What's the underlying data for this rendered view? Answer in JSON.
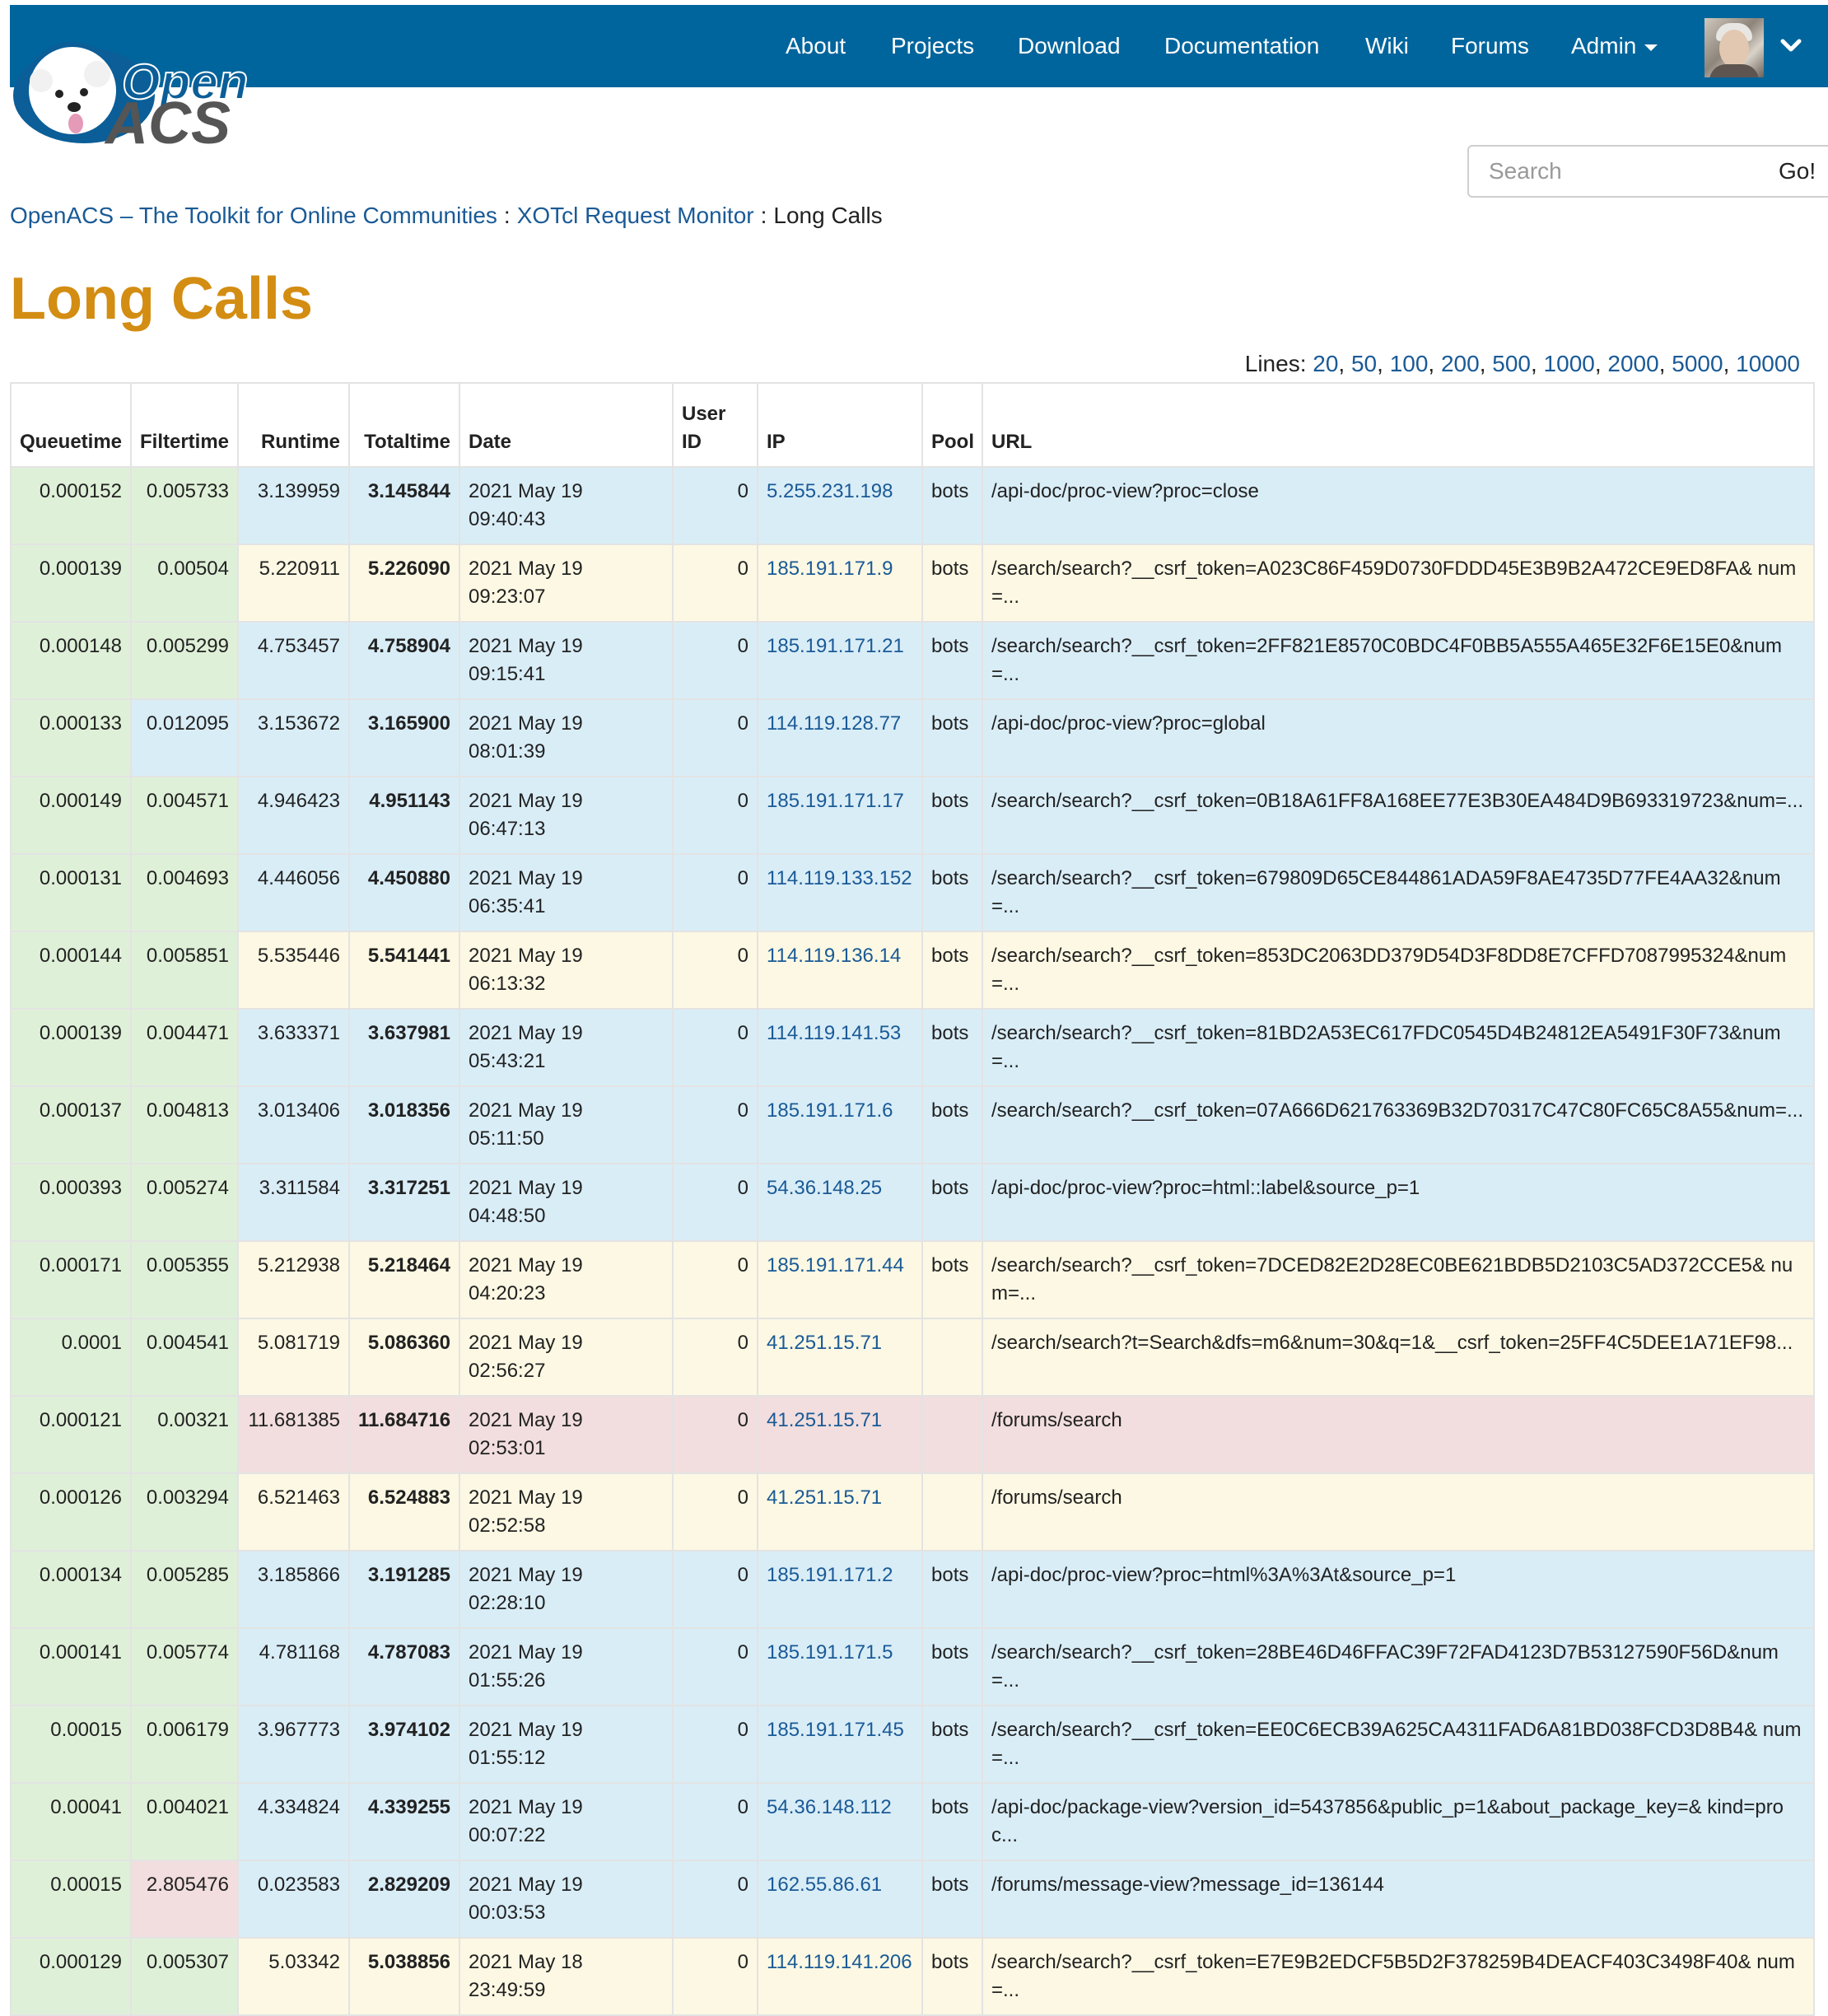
{
  "nav": {
    "items": [
      "About",
      "Projects",
      "Download",
      "Documentation",
      "Wiki",
      "Forums",
      "Admin"
    ],
    "brand_color": "#00659d"
  },
  "logo": {
    "text_top": "Open",
    "text_bottom": "ACS"
  },
  "search": {
    "placeholder": "Search",
    "button_label": "Go!"
  },
  "breadcrumb": {
    "items": [
      "OpenACS – The Toolkit for Online Communities",
      "XOTcl Request Monitor"
    ],
    "separator": ":",
    "current": "Long Calls"
  },
  "page_title": "Long Calls",
  "lines": {
    "label": "Lines:",
    "options": [
      "20",
      "50",
      "100",
      "200",
      "500",
      "1000",
      "2000",
      "5000",
      "10000"
    ]
  },
  "table": {
    "headers": [
      "Queuetime",
      "Filtertime",
      "Runtime",
      "Totaltime",
      "Date",
      "User ID",
      "IP",
      "Pool",
      "URL"
    ],
    "rows": [
      {
        "q": "0.000152",
        "f": "0.005733",
        "r": "3.139959",
        "t": "3.145844",
        "date": "2021 May 19 09:40:43",
        "uid": "0",
        "ip": "5.255.231.198",
        "pool": "bots",
        "url": "/api-doc/proc-view?proc=close",
        "fc": "green",
        "rc": "blue"
      },
      {
        "q": "0.000139",
        "f": "0.00504",
        "r": "5.220911",
        "t": "5.226090",
        "date": "2021 May 19 09:23:07",
        "uid": "0",
        "ip": "185.191.171.9",
        "pool": "bots",
        "url": "/search/search?__csrf_token=A023C86F459D0730FDDD45E3B9B2A472CE9ED8FA& num=...",
        "fc": "green",
        "rc": "yellow"
      },
      {
        "q": "0.000148",
        "f": "0.005299",
        "r": "4.753457",
        "t": "4.758904",
        "date": "2021 May 19 09:15:41",
        "uid": "0",
        "ip": "185.191.171.21",
        "pool": "bots",
        "url": "/search/search?__csrf_token=2FF821E8570C0BDC4F0BB5A555A465E32F6E15E0&num=...",
        "fc": "green",
        "rc": "blue"
      },
      {
        "q": "0.000133",
        "f": "0.012095",
        "r": "3.153672",
        "t": "3.165900",
        "date": "2021 May 19 08:01:39",
        "uid": "0",
        "ip": "114.119.128.77",
        "pool": "bots",
        "url": "/api-doc/proc-view?proc=global",
        "fc": "blue",
        "rc": "blue"
      },
      {
        "q": "0.000149",
        "f": "0.004571",
        "r": "4.946423",
        "t": "4.951143",
        "date": "2021 May 19 06:47:13",
        "uid": "0",
        "ip": "185.191.171.17",
        "pool": "bots",
        "url": "/search/search?__csrf_token=0B18A61FF8A168EE77E3B30EA484D9B693319723&num=...",
        "fc": "green",
        "rc": "blue"
      },
      {
        "q": "0.000131",
        "f": "0.004693",
        "r": "4.446056",
        "t": "4.450880",
        "date": "2021 May 19 06:35:41",
        "uid": "0",
        "ip": "114.119.133.152",
        "pool": "bots",
        "url": "/search/search?__csrf_token=679809D65CE844861ADA59F8AE4735D77FE4AA32&num=...",
        "fc": "green",
        "rc": "blue"
      },
      {
        "q": "0.000144",
        "f": "0.005851",
        "r": "5.535446",
        "t": "5.541441",
        "date": "2021 May 19 06:13:32",
        "uid": "0",
        "ip": "114.119.136.14",
        "pool": "bots",
        "url": "/search/search?__csrf_token=853DC2063DD379D54D3F8DD8E7CFFD7087995324&num=...",
        "fc": "green",
        "rc": "yellow"
      },
      {
        "q": "0.000139",
        "f": "0.004471",
        "r": "3.633371",
        "t": "3.637981",
        "date": "2021 May 19 05:43:21",
        "uid": "0",
        "ip": "114.119.141.53",
        "pool": "bots",
        "url": "/search/search?__csrf_token=81BD2A53EC617FDC0545D4B24812EA5491F30F73&num=...",
        "fc": "green",
        "rc": "blue"
      },
      {
        "q": "0.000137",
        "f": "0.004813",
        "r": "3.013406",
        "t": "3.018356",
        "date": "2021 May 19 05:11:50",
        "uid": "0",
        "ip": "185.191.171.6",
        "pool": "bots",
        "url": "/search/search?__csrf_token=07A666D621763369B32D70317C47C80FC65C8A55&num=...",
        "fc": "green",
        "rc": "blue"
      },
      {
        "q": "0.000393",
        "f": "0.005274",
        "r": "3.311584",
        "t": "3.317251",
        "date": "2021 May 19 04:48:50",
        "uid": "0",
        "ip": "54.36.148.25",
        "pool": "bots",
        "url": "/api-doc/proc-view?proc=html::label&source_p=1",
        "fc": "green",
        "rc": "blue"
      },
      {
        "q": "0.000171",
        "f": "0.005355",
        "r": "5.212938",
        "t": "5.218464",
        "date": "2021 May 19 04:20:23",
        "uid": "0",
        "ip": "185.191.171.44",
        "pool": "bots",
        "url": "/search/search?__csrf_token=7DCED82E2D28EC0BE621BDB5D2103C5AD372CCE5& num=...",
        "fc": "green",
        "rc": "yellow"
      },
      {
        "q": "0.0001",
        "f": "0.004541",
        "r": "5.081719",
        "t": "5.086360",
        "date": "2021 May 19 02:56:27",
        "uid": "0",
        "ip": "41.251.15.71",
        "pool": "",
        "url": "/search/search?t=Search&dfs=m6&num=30&q=1&__csrf_token=25FF4C5DEE1A71EF98...",
        "fc": "green",
        "rc": "yellow"
      },
      {
        "q": "0.000121",
        "f": "0.00321",
        "r": "11.681385",
        "t": "11.684716",
        "date": "2021 May 19 02:53:01",
        "uid": "0",
        "ip": "41.251.15.71",
        "pool": "",
        "url": "/forums/search",
        "fc": "green",
        "rc": "red"
      },
      {
        "q": "0.000126",
        "f": "0.003294",
        "r": "6.521463",
        "t": "6.524883",
        "date": "2021 May 19 02:52:58",
        "uid": "0",
        "ip": "41.251.15.71",
        "pool": "",
        "url": "/forums/search",
        "fc": "green",
        "rc": "yellow"
      },
      {
        "q": "0.000134",
        "f": "0.005285",
        "r": "3.185866",
        "t": "3.191285",
        "date": "2021 May 19 02:28:10",
        "uid": "0",
        "ip": "185.191.171.2",
        "pool": "bots",
        "url": "/api-doc/proc-view?proc=html%3A%3At&source_p=1",
        "fc": "green",
        "rc": "blue"
      },
      {
        "q": "0.000141",
        "f": "0.005774",
        "r": "4.781168",
        "t": "4.787083",
        "date": "2021 May 19 01:55:26",
        "uid": "0",
        "ip": "185.191.171.5",
        "pool": "bots",
        "url": "/search/search?__csrf_token=28BE46D46FFAC39F72FAD4123D7B53127590F56D&num=...",
        "fc": "green",
        "rc": "blue"
      },
      {
        "q": "0.00015",
        "f": "0.006179",
        "r": "3.967773",
        "t": "3.974102",
        "date": "2021 May 19 01:55:12",
        "uid": "0",
        "ip": "185.191.171.45",
        "pool": "bots",
        "url": "/search/search?__csrf_token=EE0C6ECB39A625CA4311FAD6A81BD038FCD3D8B4& num=...",
        "fc": "green",
        "rc": "blue"
      },
      {
        "q": "0.00041",
        "f": "0.004021",
        "r": "4.334824",
        "t": "4.339255",
        "date": "2021 May 19 00:07:22",
        "uid": "0",
        "ip": "54.36.148.112",
        "pool": "bots",
        "url": "/api-doc/package-view?version_id=5437856&public_p=1&about_package_key=& kind=proc...",
        "fc": "green",
        "rc": "blue"
      },
      {
        "q": "0.00015",
        "f": "2.805476",
        "r": "0.023583",
        "t": "2.829209",
        "date": "2021 May 19 00:03:53",
        "uid": "0",
        "ip": "162.55.86.61",
        "pool": "bots",
        "url": "/forums/message-view?message_id=136144",
        "fc": "red",
        "rc": "blue"
      },
      {
        "q": "0.000129",
        "f": "0.005307",
        "r": "5.03342",
        "t": "5.038856",
        "date": "2021 May 18 23:49:59",
        "uid": "0",
        "ip": "114.119.141.206",
        "pool": "bots",
        "url": "/search/search?__csrf_token=E7E9B2EDCF5B5D2F378259B4DEACF403C3498F40& num=...",
        "fc": "green",
        "rc": "yellow"
      }
    ]
  }
}
